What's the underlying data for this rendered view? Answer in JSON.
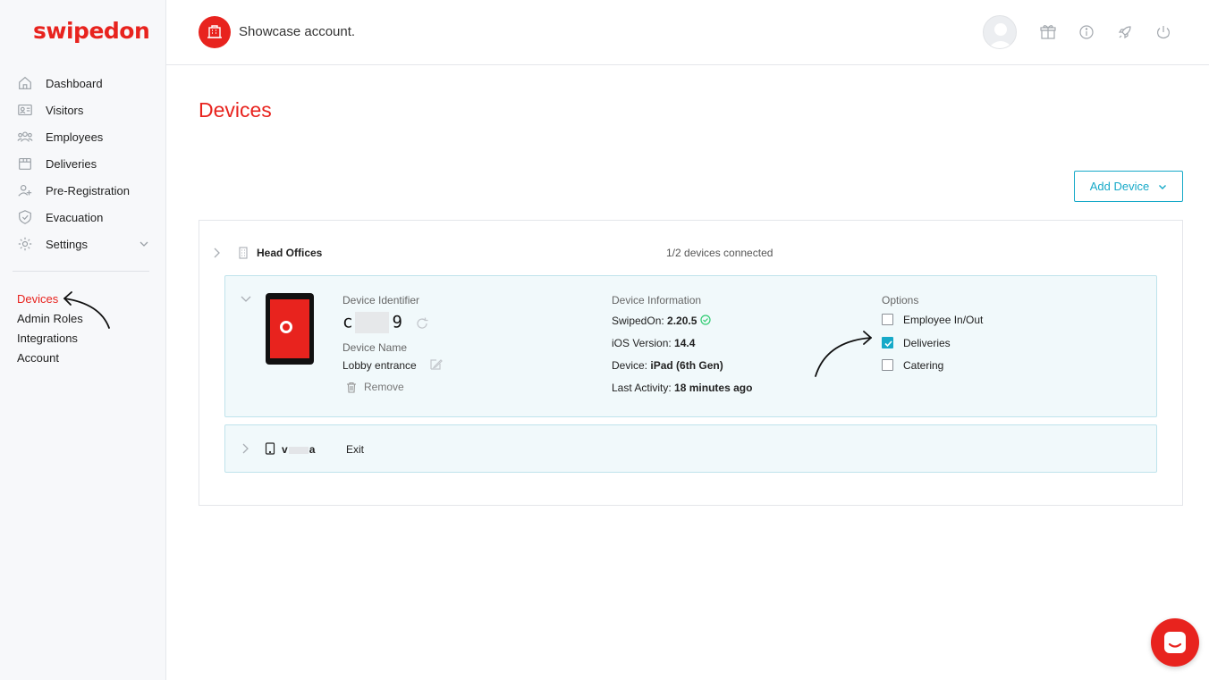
{
  "brand": {
    "logo": "swipedon",
    "accent": "#e8231e",
    "link": "#16a9c8"
  },
  "sidebar": {
    "items": [
      {
        "label": "Dashboard",
        "icon": "home-icon"
      },
      {
        "label": "Visitors",
        "icon": "id-card-icon"
      },
      {
        "label": "Employees",
        "icon": "people-icon"
      },
      {
        "label": "Deliveries",
        "icon": "box-icon"
      },
      {
        "label": "Pre-Registration",
        "icon": "user-plus-icon"
      },
      {
        "label": "Evacuation",
        "icon": "shield-icon"
      },
      {
        "label": "Settings",
        "icon": "gear-icon"
      }
    ],
    "subitems": [
      {
        "label": "Devices",
        "active": true
      },
      {
        "label": "Admin Roles"
      },
      {
        "label": "Integrations"
      },
      {
        "label": "Account"
      }
    ]
  },
  "header": {
    "account_name": "Showcase account.",
    "icons": [
      "gift-icon",
      "info-icon",
      "rocket-icon",
      "power-icon"
    ]
  },
  "main": {
    "title": "Devices",
    "add_device_label": "Add Device",
    "location": {
      "name": "Head Offices",
      "connected": "1/2 devices connected"
    },
    "device": {
      "identifier_label": "Device Identifier",
      "identifier_start": "c",
      "identifier_end": "9",
      "name_label": "Device Name",
      "name": "Lobby entrance",
      "remove_label": "Remove",
      "info_label": "Device Information",
      "swipedon_label": "SwipedOn:",
      "swipedon_version": "2.20.5",
      "ios_label": "iOS Version:",
      "ios_version": "14.4",
      "device_label": "Device:",
      "device_model": "iPad (6th Gen)",
      "activity_label": "Last Activity:",
      "activity": "18 minutes ago",
      "options_label": "Options",
      "options": [
        {
          "label": "Employee In/Out",
          "checked": false
        },
        {
          "label": "Deliveries",
          "checked": true
        },
        {
          "label": "Catering",
          "checked": false
        }
      ]
    },
    "device2": {
      "identifier_start": "v",
      "identifier_end": "a",
      "name": "Exit"
    }
  }
}
